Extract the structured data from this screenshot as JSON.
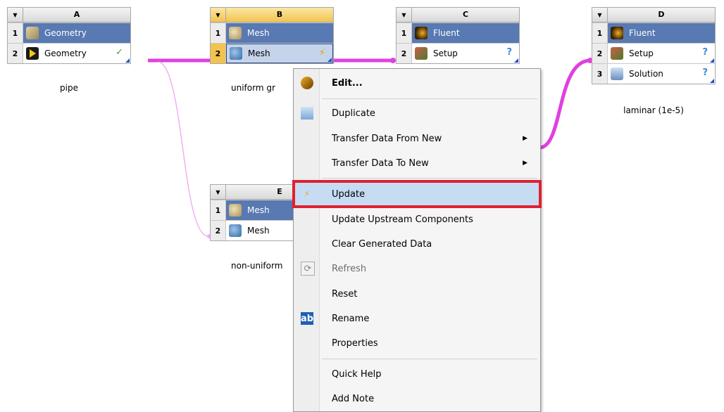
{
  "systems": {
    "A": {
      "letter": "A",
      "name": "pipe",
      "cells": [
        {
          "num": "1",
          "label": "Geometry"
        },
        {
          "num": "2",
          "label": "Geometry",
          "state": "✓"
        }
      ]
    },
    "B": {
      "letter": "B",
      "name": "uniform gr",
      "cells": [
        {
          "num": "1",
          "label": "Mesh"
        },
        {
          "num": "2",
          "label": "Mesh",
          "state": "⚡"
        }
      ]
    },
    "C": {
      "letter": "C",
      "cells": [
        {
          "num": "1",
          "label": "Fluent"
        },
        {
          "num": "2",
          "label": "Setup",
          "state": "?"
        }
      ]
    },
    "D": {
      "letter": "D",
      "name": "laminar (1e-5)",
      "cells": [
        {
          "num": "1",
          "label": "Fluent"
        },
        {
          "num": "2",
          "label": "Setup",
          "state": "?"
        },
        {
          "num": "3",
          "label": "Solution",
          "state": "?"
        }
      ]
    },
    "E": {
      "letter": "E",
      "name": "non-uniform",
      "cells": [
        {
          "num": "1",
          "label": "Mesh"
        },
        {
          "num": "2",
          "label": "Mesh"
        }
      ]
    }
  },
  "context_menu": {
    "items": [
      {
        "label": "Edit...",
        "icon": "edit-gear-icon"
      },
      {
        "label": "Duplicate",
        "icon": "duplicate-icon"
      },
      {
        "label": "Transfer Data From New",
        "submenu": true
      },
      {
        "label": "Transfer Data To New",
        "submenu": true
      },
      {
        "label": "Update",
        "icon": "lightning-icon",
        "highlighted": true
      },
      {
        "label": "Update Upstream Components"
      },
      {
        "label": "Clear Generated Data"
      },
      {
        "label": "Refresh",
        "icon": "refresh-icon",
        "disabled": true
      },
      {
        "label": "Reset"
      },
      {
        "label": "Rename",
        "icon": "rename-icon"
      },
      {
        "label": "Properties"
      },
      {
        "label": "Quick Help"
      },
      {
        "label": "Add Note"
      }
    ]
  },
  "colors": {
    "link": "#e040e0",
    "link_light": "#f0b0f0",
    "highlight_box": "#e02030",
    "cell_blue": "#5879b2",
    "header_selected": "#f2c44f"
  }
}
